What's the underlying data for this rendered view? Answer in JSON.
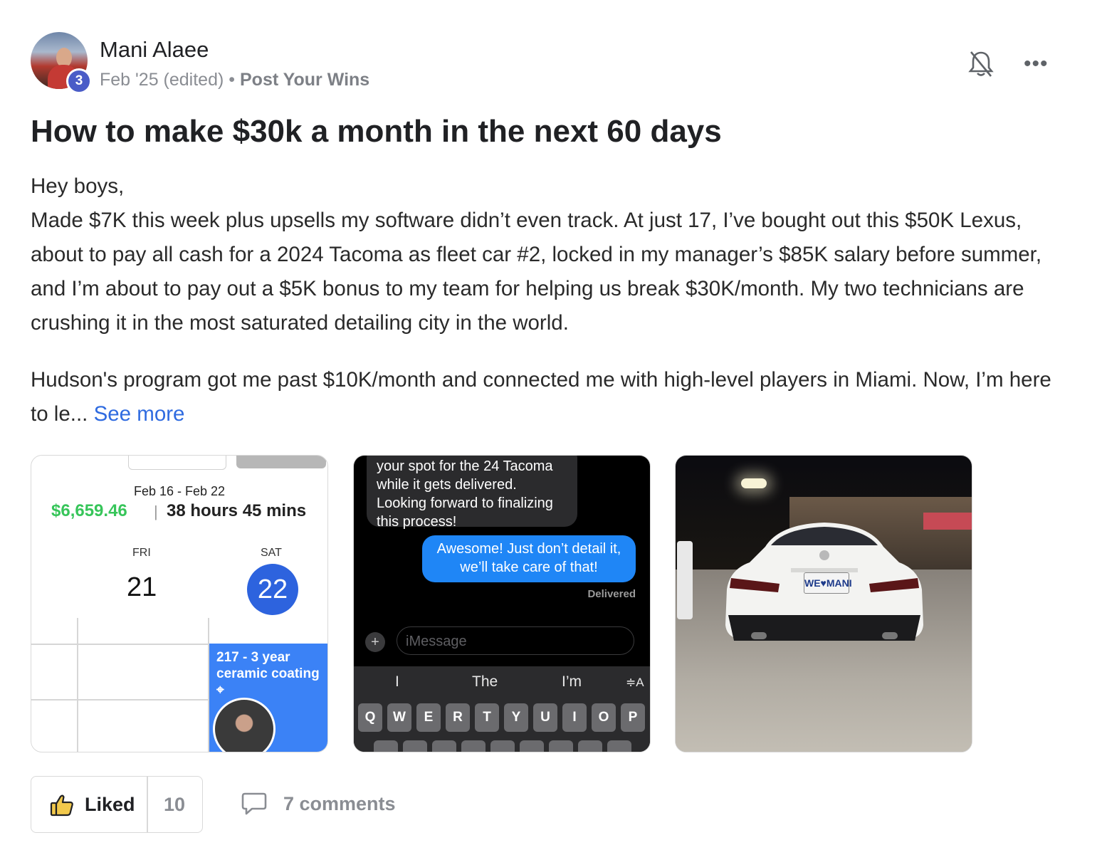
{
  "post": {
    "author": "Mani Alaee",
    "level": "3",
    "date": "Feb '25 (edited)",
    "separator": "•",
    "category": "Post Your Wins",
    "title": "How to make $30k a month in the next 60 days",
    "paragraph1_line1": "Hey boys,",
    "paragraph1_rest": "Made $7K this week plus upsells my software didn’t even track. At just 17, I’ve bought out this $50K Lexus, about to pay all cash for a 2024 Tacoma as fleet car #2, locked in my manager’s $85K salary before summer, and I’m about to pay out a $5K bonus to my team for helping us break $30K/month. My two technicians are crushing it in the most saturated detailing city in the world.",
    "paragraph2": "Hudson's program got me past $10K/month and connected me with high-level players in Miami. Now, I’m here to le...",
    "see_more": "See more",
    "more_icon": "•••"
  },
  "attachments": {
    "calendar": {
      "date_range": "Feb 16 - Feb 22",
      "earnings": "$6,659.46",
      "sep": "|",
      "hours": "38 hours 45 mins",
      "day1_name": "FRI",
      "day1_num": "21",
      "day2_name": "SAT",
      "day2_num": "22",
      "event": "217 - 3 year ceramic coating"
    },
    "imessage": {
      "incoming": "your spot for the 24 Tacoma while it gets delivered. Looking forward to finalizing this process!",
      "outgoing": "Awesome! Just don’t detail it, we’ll take care of that!",
      "delivered": "Delivered",
      "placeholder": "iMessage",
      "plus": "+",
      "suggestions": [
        "I",
        "The",
        "I’m",
        "≑A"
      ],
      "keys": [
        "Q",
        "W",
        "E",
        "R",
        "T",
        "Y",
        "U",
        "I",
        "O",
        "P"
      ]
    },
    "car_photo": {
      "plate": "WE♥MANI"
    }
  },
  "footer": {
    "liked_label": "Liked",
    "like_count": "10",
    "comments_label": "7 comments"
  },
  "colors": {
    "accent_link": "#2f6be0",
    "badge": "#4a5cc7",
    "earnings_green": "#37c55a",
    "calendar_blue": "#2d63de",
    "imessage_blue": "#1f86f6"
  }
}
